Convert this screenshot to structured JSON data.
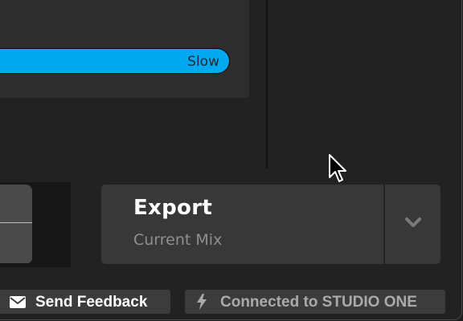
{
  "speed_slider": {
    "label": "Slow"
  },
  "export": {
    "title": "Export",
    "subtitle": "Current Mix",
    "dropdown_icon": "chevron-down-icon"
  },
  "footer": {
    "feedback_label": "Send Feedback",
    "feedback_icon": "envelope-icon",
    "connection_label": "Connected to STUDIO ONE",
    "connection_icon": "lightning-icon"
  },
  "colors": {
    "accent": "#00a8f0",
    "background": "#222222",
    "panel": "#383838"
  }
}
